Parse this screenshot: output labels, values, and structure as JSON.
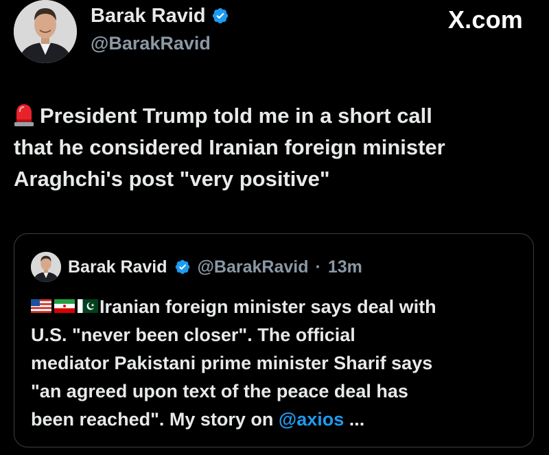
{
  "author": {
    "display_name": "Barak Ravid",
    "handle": "@BarakRavid",
    "verified": true,
    "avatar": "person-avatar"
  },
  "source_label": "X.com",
  "post": {
    "emoji": "police-siren-icon",
    "lines": [
      "President Trump told me in a short call",
      "that he considered Iranian foreign minister",
      "Araghchi's post \"very positive\""
    ]
  },
  "quoted_post": {
    "display_name": "Barak Ravid",
    "handle": "@BarakRavid",
    "separator": "·",
    "time": "13m",
    "flags": [
      "us-flag-icon",
      "iran-flag-icon",
      "pakistan-flag-icon"
    ],
    "lines": [
      "Iranian foreign minister says deal with",
      "U.S. \"never been closer\". The official",
      "mediator Pakistani prime minister Sharif says",
      "\"an agreed upon text of the peace deal has",
      "been reached\". My story on "
    ],
    "mention": "@axios",
    "truncation": " ..."
  },
  "colors": {
    "background": "#000000",
    "text": "#e7e9ea",
    "muted": "#8b98a5",
    "accent": "#1d9bf0",
    "border": "#3a3f44"
  }
}
